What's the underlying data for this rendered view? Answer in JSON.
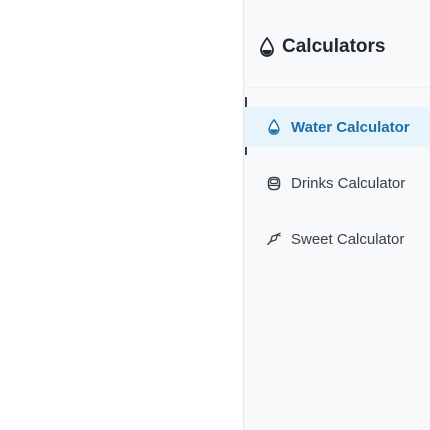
{
  "sidebar": {
    "title": "Calculators",
    "title_icon": "water-drop-icon",
    "items": [
      {
        "label": "Water Calculator",
        "icon": "water-drop-icon",
        "active": true
      },
      {
        "label": "Drinks Calculator",
        "icon": "drink-cup-icon",
        "active": false
      },
      {
        "label": "Sweet Calculator",
        "icon": "candy-icon",
        "active": false
      }
    ]
  },
  "colors": {
    "sidebar_bg": "#f8f9fa",
    "active_bg": "#e8f4fb",
    "active_text": "#1c6fa8",
    "text": "#3a4047",
    "title_text": "#22282e"
  }
}
